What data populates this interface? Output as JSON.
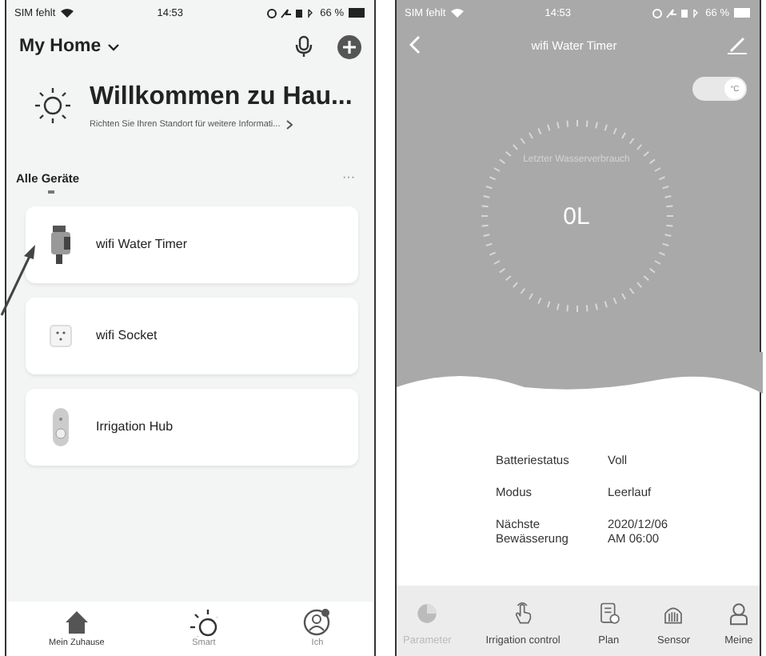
{
  "home_screen": {
    "status_bar": {
      "carrier": "SIM fehlt",
      "time": "14:53",
      "battery": "66 %"
    },
    "title": "My Home",
    "welcome": {
      "heading": "Willkommen zu Hau...",
      "subtitle": "Richten Sie Ihren Standort für weitere Informati..."
    },
    "section_title": "Alle Geräte",
    "more": "···",
    "devices": [
      {
        "name": "wifi Water Timer",
        "kind": "timer"
      },
      {
        "name": "wifi Socket",
        "kind": "socket"
      },
      {
        "name": "Irrigation Hub",
        "kind": "hub"
      }
    ],
    "tab_bar": [
      {
        "label": "Mein Zuhause",
        "kind": "home",
        "selected": true
      },
      {
        "label": "Smart",
        "kind": "smart",
        "selected": false
      },
      {
        "label": "Ich",
        "kind": "me",
        "selected": false
      }
    ]
  },
  "device_screen": {
    "status_bar": {
      "carrier": "SIM fehlt",
      "time": "14:53",
      "battery": "66 %"
    },
    "title": "wifi Water Timer",
    "unit_toggle": {
      "label": "°C",
      "on": true
    },
    "gauge": {
      "caption": "Letzter Wasserverbrauch",
      "value": "0L"
    },
    "details": [
      {
        "label": "Batteriestatus",
        "value": "Voll"
      },
      {
        "label": "Modus",
        "value": "Leerlauf"
      },
      {
        "label": "Nächste\nBewässerung",
        "value": "2020/12/06\nAM 06:00"
      }
    ],
    "tab_bar": [
      {
        "label": "Parameter",
        "kind": "pie",
        "selected": true
      },
      {
        "label": "Irrigation control",
        "kind": "hand",
        "selected": false
      },
      {
        "label": "Plan",
        "kind": "plan",
        "selected": false
      },
      {
        "label": "Sensor",
        "kind": "sensor",
        "selected": false
      },
      {
        "label": "Meine",
        "kind": "person",
        "selected": false
      }
    ]
  }
}
